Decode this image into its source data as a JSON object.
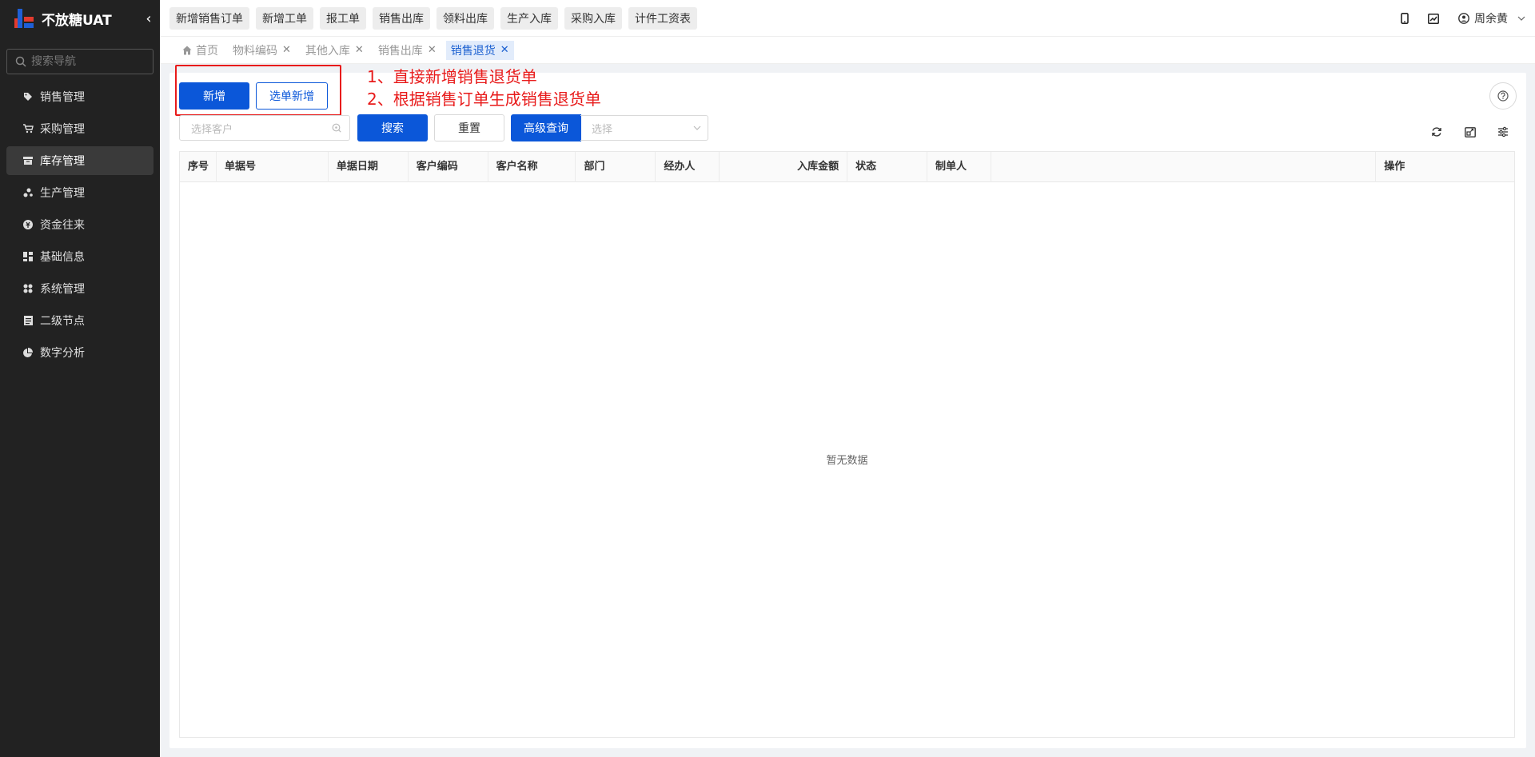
{
  "brand": {
    "title": "不放糖UAT"
  },
  "sidebar": {
    "search_placeholder": "搜索导航",
    "items": [
      {
        "label": "销售管理",
        "icon": "tag-icon"
      },
      {
        "label": "采购管理",
        "icon": "cart-icon"
      },
      {
        "label": "库存管理",
        "icon": "archive-icon",
        "active": true
      },
      {
        "label": "生产管理",
        "icon": "cluster-icon"
      },
      {
        "label": "资金往来",
        "icon": "money-icon"
      },
      {
        "label": "基础信息",
        "icon": "dashboard-icon"
      },
      {
        "label": "系统管理",
        "icon": "apps-icon"
      },
      {
        "label": "二级节点",
        "icon": "list-icon"
      },
      {
        "label": "数字分析",
        "icon": "pie-icon"
      }
    ]
  },
  "topbar": {
    "quick_links": [
      "新增销售订单",
      "新增工单",
      "报工单",
      "销售出库",
      "领料出库",
      "生产入库",
      "采购入库",
      "计件工资表"
    ],
    "username": "周余黄"
  },
  "tabs": [
    {
      "label": "首页",
      "closable": false,
      "icon": "home-icon"
    },
    {
      "label": "物料编码",
      "closable": true
    },
    {
      "label": "其他入库",
      "closable": true
    },
    {
      "label": "销售出库",
      "closable": true
    },
    {
      "label": "销售退货",
      "closable": true,
      "active": true
    }
  ],
  "toolbar": {
    "add_label": "新增",
    "select_add_label": "选单新增",
    "customer_placeholder": "选择客户",
    "search_label": "搜索",
    "reset_label": "重置",
    "advanced_label": "高级查询",
    "advanced_placeholder": "选择"
  },
  "annotations": [
    "1、直接新增销售退货单",
    "2、根据销售订单生成销售退货单"
  ],
  "table": {
    "columns": [
      "序号",
      "单据号",
      "单据日期",
      "客户编码",
      "客户名称",
      "部门",
      "经办人",
      "入库金额",
      "状态",
      "制单人",
      "",
      "操作"
    ],
    "empty_text": "暂无数据"
  },
  "colors": {
    "primary": "#0b57d9",
    "sidebar_bg": "#222222",
    "annotation": "#e81a1a"
  }
}
